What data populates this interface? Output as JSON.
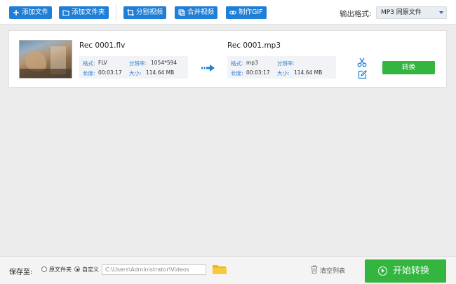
{
  "toolbar": {
    "add_file": "添加文件",
    "add_folder": "添加文件夹",
    "split_video": "分割视频",
    "merge_video": "合并视频",
    "make_gif": "制作GIF",
    "output_format_label": "输出格式:",
    "output_format_value": "MP3  同原文件",
    "accent_color": "#1f7ed6"
  },
  "file": {
    "source": {
      "name": "Rec 0001.flv",
      "format_label": "格式:",
      "format_value": "FLV",
      "resolution_label": "分辨率:",
      "resolution_value": "1054*594",
      "duration_label": "长度:",
      "duration_value": "00:03:17",
      "size_label": "大小:",
      "size_value": "114.64 MB"
    },
    "target": {
      "name": "Rec 0001.mp3",
      "format_label": "格式:",
      "format_value": "mp3",
      "resolution_label": "分辨率:",
      "resolution_value": "",
      "duration_label": "长度:",
      "duration_value": "00:03:17",
      "size_label": "大小:",
      "size_value": "114.64 MB"
    },
    "convert_label": "转换",
    "convert_color": "#33b540"
  },
  "bottom": {
    "save_label": "保存至:",
    "option_original": "原文件夹",
    "option_custom": "自定义",
    "selected_option": "custom",
    "path_value": "C:\\Users\\Administrator\\Videos",
    "clear_label": "清空列表",
    "start_label": "开始转换"
  }
}
